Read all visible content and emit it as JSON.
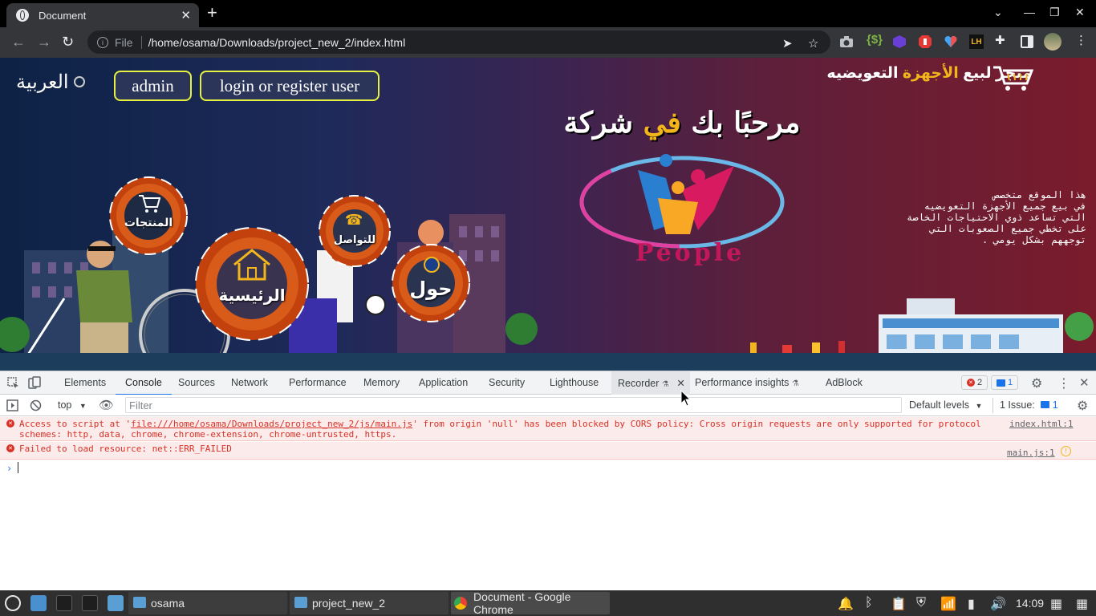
{
  "browser": {
    "tab_title": "Document",
    "url_scheme_label": "File",
    "url_path": "/home/osama/Downloads/project_new_2/index.html"
  },
  "page": {
    "language_label": "العربية",
    "admin_button": "admin",
    "login_button": "login or register user",
    "store_title_prefix": "متجر لبيع",
    "store_title_highlight": "الأجهزة",
    "store_title_suffix": "التعويضيه",
    "welcome_prefix": "مرحبًا بك",
    "welcome_highlight": "في",
    "welcome_suffix": "شركة",
    "description_lines": [
      "هذا الموقع متخصص",
      "في بيع جميع الأجهزة التعويضيه",
      "التي تساعد ذوي الاحتياجات الخاصة",
      "على تخطي جميع الصعوبات التي",
      "توجههم بشكل يومي ."
    ],
    "logo_text": "People",
    "gears": {
      "products": "المنتجات",
      "contact": "للتواصل",
      "home": "الرئيسية",
      "about": "حول"
    }
  },
  "devtools": {
    "tabs": [
      "Elements",
      "Console",
      "Sources",
      "Network",
      "Performance",
      "Memory",
      "Application",
      "Security",
      "Lighthouse",
      "Recorder",
      "Performance insights",
      "AdBlock"
    ],
    "error_count": "2",
    "message_count": "1",
    "context": "top",
    "filter_placeholder": "Filter",
    "levels": "Default levels",
    "issues_label": "1 Issue:",
    "issues_count": "1",
    "messages": [
      {
        "prefix": "Access to script at '",
        "link": "file:///home/osama/Downloads/project_new_2/js/main.js",
        "suffix": "' from origin 'null' has been blocked by CORS policy: Cross origin requests are only supported for protocol schemes: http, data, chrome, chrome-extension, chrome-untrusted, https.",
        "source": "index.html:1"
      },
      {
        "prefix": "Failed to load resource: net::ERR_FAILED",
        "source": "main.js:1"
      }
    ]
  },
  "taskbar": {
    "tasks": [
      "osama",
      "project_new_2",
      "Document - Google Chrome"
    ],
    "clock": "14:09"
  },
  "colors": {
    "accent_yellow": "#f2b51b",
    "button_border": "#e7f240",
    "devtools_blue": "#1a73e8",
    "error_red": "#d93025"
  }
}
